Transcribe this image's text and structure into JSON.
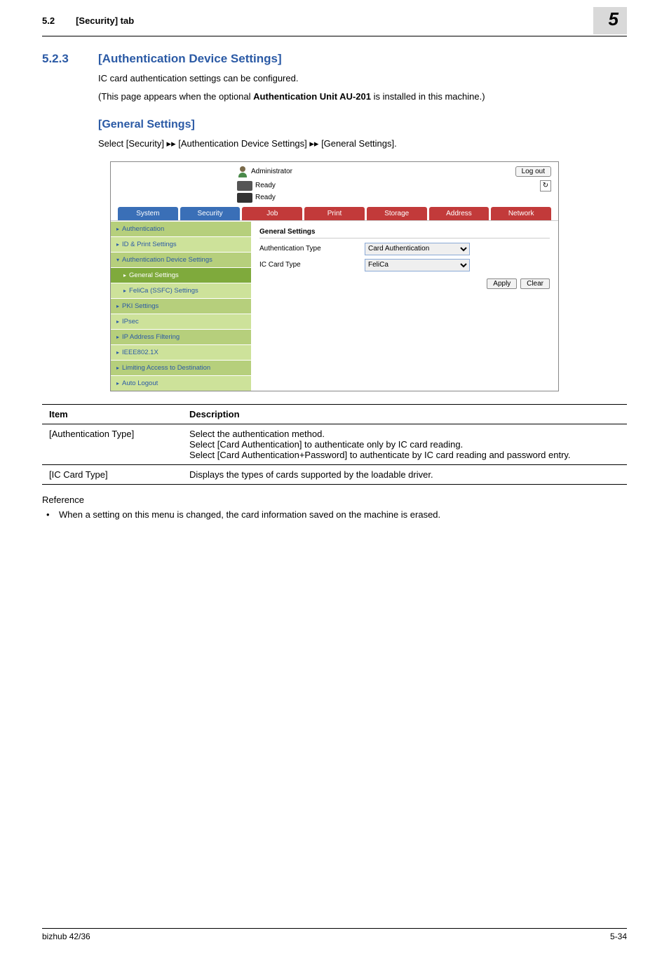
{
  "header": {
    "section_num": "5.2",
    "section_title": "[Security] tab",
    "chapter": "5"
  },
  "h523": {
    "num": "5.2.3",
    "title": "[Authentication Device Settings]"
  },
  "intro": {
    "p1": "IC card authentication settings can be configured.",
    "p2_pre": "(This page appears when the optional ",
    "p2_bold": "Authentication Unit AU-201",
    "p2_post": " is installed in this machine.)"
  },
  "general": {
    "heading": "[General Settings]",
    "path_pre": "Select [Security] ",
    "path_mid1": " [Authentication Device Settings] ",
    "path_end": " [General Settings].",
    "arrows": "▸▸"
  },
  "ss": {
    "admin": "Administrator",
    "logout": "Log out",
    "ready": "Ready",
    "refresh_icon": "↻",
    "tabs": {
      "system": "System",
      "security": "Security",
      "job": "Job",
      "print": "Print",
      "storage": "Storage",
      "address": "Address",
      "network": "Network"
    },
    "nav": {
      "auth": "Authentication",
      "idprint": "ID & Print Settings",
      "authdev": "Authentication Device Settings",
      "general": "General Settings",
      "felica": "FeliCa (SSFC) Settings",
      "pki": "PKI Settings",
      "ipsec": "IPsec",
      "ipaddr": "IP Address Filtering",
      "ieee": "IEEE802.1X",
      "limiting": "Limiting Access to Destination",
      "autologout": "Auto Logout"
    },
    "panel": {
      "title": "General Settings",
      "authtype_lbl": "Authentication Type",
      "authtype_val": "Card Authentication",
      "iccard_lbl": "IC Card Type",
      "iccard_val": "FeliCa",
      "apply": "Apply",
      "clear": "Clear"
    }
  },
  "table": {
    "h_item": "Item",
    "h_desc": "Description",
    "r1_item": "[Authentication Type]",
    "r1_desc": "Select the authentication method.\nSelect [Card Authentication] to authenticate only by IC card reading.\nSelect [Card Authentication+Password] to authenticate by IC card reading and password entry.",
    "r2_item": "[IC Card Type]",
    "r2_desc": "Displays the types of cards supported by the loadable driver."
  },
  "reference": {
    "label": "Reference",
    "bullet": "When a setting on this menu is changed, the card information saved on the machine is erased."
  },
  "footer": {
    "left": "bizhub 42/36",
    "right": "5-34"
  }
}
